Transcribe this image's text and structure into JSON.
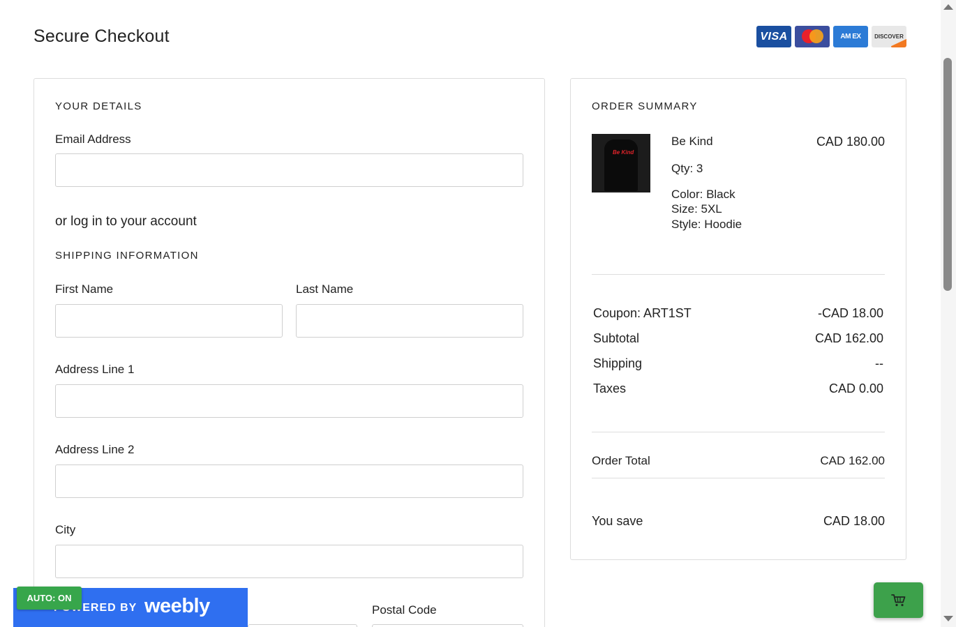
{
  "header": {
    "title": "Secure Checkout",
    "card_logos": {
      "visa": "VISA",
      "amex": "AM EX",
      "discover": "DISCOVER"
    }
  },
  "details": {
    "heading": "YOUR DETAILS",
    "email_label": "Email Address",
    "email_value": "",
    "login_link": "or log in to your account"
  },
  "shipping": {
    "heading": "SHIPPING INFORMATION",
    "first_name_label": "First Name",
    "last_name_label": "Last Name",
    "address1_label": "Address Line 1",
    "address2_label": "Address Line 2",
    "city_label": "City",
    "postal_label": "Postal Code"
  },
  "summary": {
    "heading": "ORDER SUMMARY",
    "item": {
      "name": "Be Kind",
      "price": "CAD 180.00",
      "qty": "Qty: 3",
      "color": "Color: Black",
      "size": "Size: 5XL",
      "style": "Style: Hoodie",
      "thumb_text": "Be Kind"
    },
    "coupon_label": "Coupon: ART1ST",
    "coupon_value": "-CAD 18.00",
    "subtotal_label": "Subtotal",
    "subtotal_value": "CAD 162.00",
    "shipping_label": "Shipping",
    "shipping_value": "--",
    "taxes_label": "Taxes",
    "taxes_value": "CAD 0.00",
    "total_label": "Order Total",
    "total_value": "CAD 162.00",
    "save_label": "You save",
    "save_value": "CAD 18.00"
  },
  "footer": {
    "powered_by": "POWERED BY",
    "brand": "weebly",
    "auto_badge": "AUTO: ON"
  },
  "icons": {
    "cart": "cart-icon"
  }
}
